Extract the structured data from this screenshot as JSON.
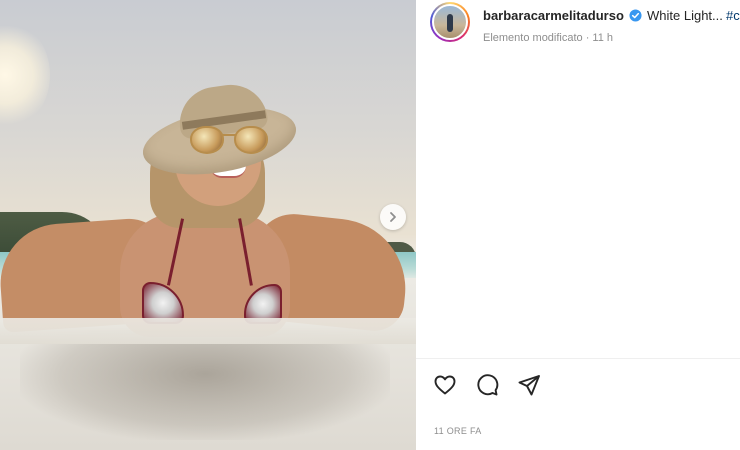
{
  "post": {
    "media": {
      "alt_icon": "photo",
      "carousel_next_icon": "chevron-right-icon"
    },
    "header": {
      "username": "barbaracarmelitadurso",
      "verified_icon": "verified-badge-icon",
      "caption_preview": "White Light...",
      "hashtag_preview": "#c",
      "status": "Elemento modificato · 11 h"
    },
    "actions": {
      "like_icon": "heart-icon",
      "comment_icon": "comment-icon",
      "share_icon": "share-icon"
    },
    "timestamp": "11 ORE FA"
  },
  "colors": {
    "verified": "#3897f0",
    "text_primary": "#262626",
    "text_secondary": "#8e8e8e",
    "hashtag": "#00376b"
  }
}
